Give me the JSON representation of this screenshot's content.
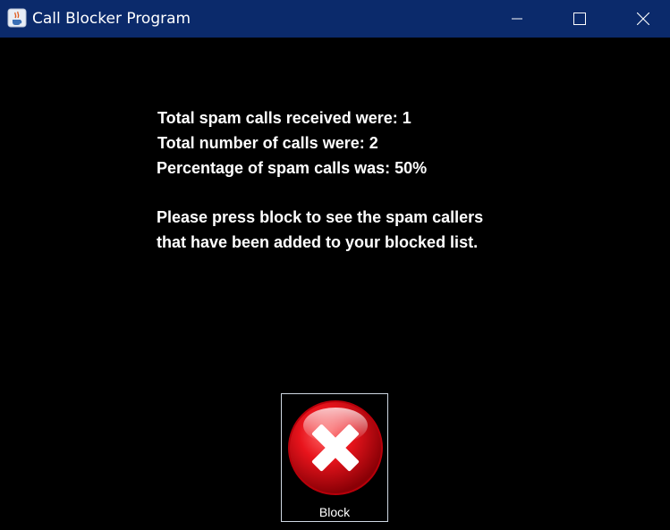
{
  "window": {
    "title": "Call Blocker Program",
    "titlebar_color": "#0b2a6b",
    "icons": {
      "app": "java-coffee-icon",
      "minimize": "minimize-icon",
      "maximize": "maximize-icon",
      "close": "close-icon"
    }
  },
  "summary": {
    "spam_line": "Total spam calls received were: 1",
    "total_line": "Total number of calls were: 2",
    "percent_line": "Percentage of spam calls was: 50%",
    "instruction_line1": "Please press block to see the spam callers",
    "instruction_line2": "that have been added to your blocked list."
  },
  "block_button": {
    "label": "Block",
    "icon": "red-x-block-icon",
    "icon_color": "#e8141c"
  }
}
